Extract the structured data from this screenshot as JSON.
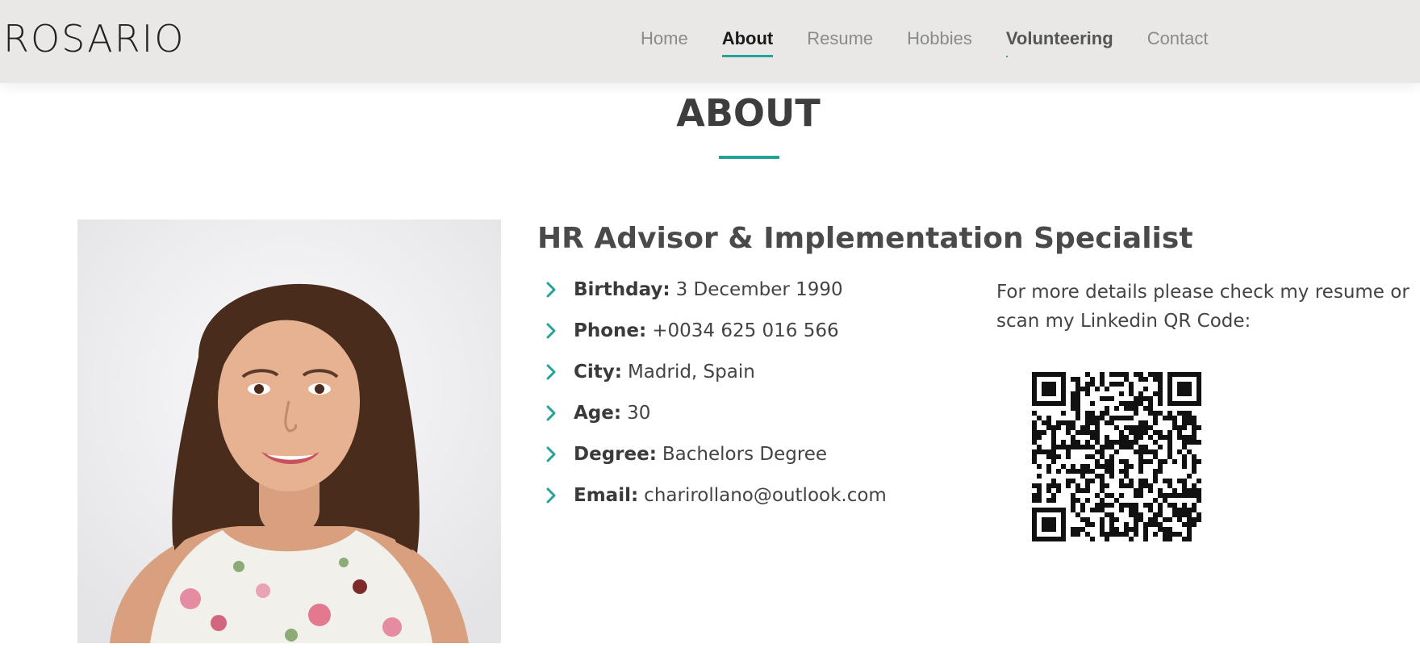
{
  "header": {
    "logo": "ROSARIO",
    "nav": [
      {
        "label": "Home"
      },
      {
        "label": "About"
      },
      {
        "label": "Resume"
      },
      {
        "label": "Hobbies"
      },
      {
        "label": "Volunteering"
      },
      {
        "label": "Contact"
      }
    ],
    "active_nav": "About"
  },
  "about": {
    "section_title": "ABOUT",
    "role": "HR Advisor & Implementation Specialist",
    "info": [
      {
        "label": "Birthday:",
        "value": "3 December 1990"
      },
      {
        "label": "Phone:",
        "value": "+0034 625 016 566"
      },
      {
        "label": "City:",
        "value": "Madrid, Spain"
      },
      {
        "label": "Age:",
        "value": "30"
      },
      {
        "label": "Degree:",
        "value": "Bachelors Degree"
      },
      {
        "label": "Email:",
        "value": "charirollano@outlook.com"
      }
    ],
    "details_text": "For more details please check my resume or scan my Linkedin QR Code:"
  },
  "icons": {
    "list_bullet": "chevron-right-icon",
    "qr": "linkedin-qr-code"
  },
  "colors": {
    "accent": "#24a39a",
    "header_bg": "#e9e8e7",
    "text": "#444444"
  }
}
